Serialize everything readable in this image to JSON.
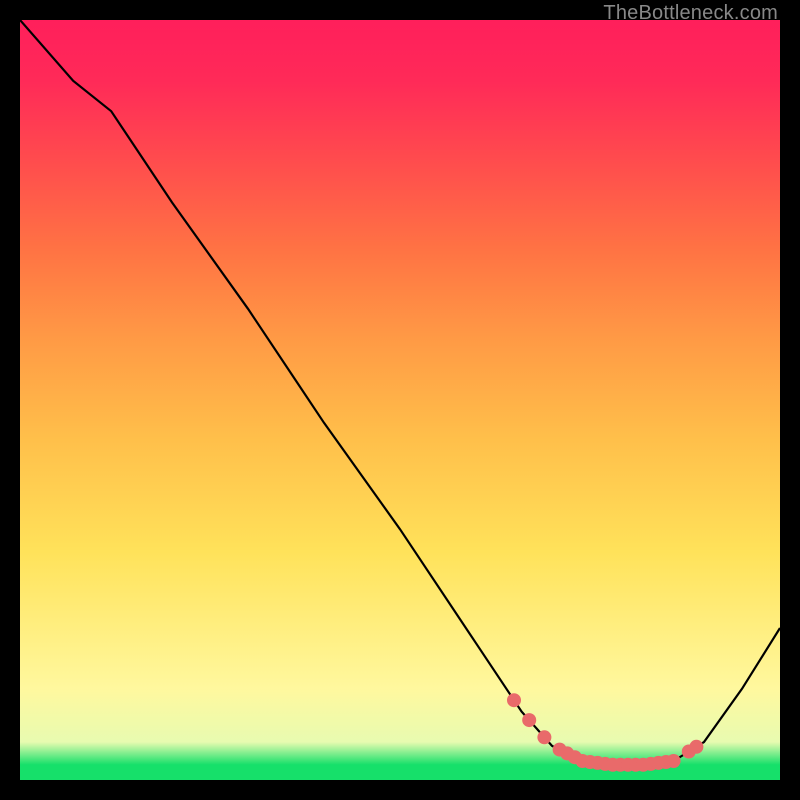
{
  "attribution": "TheBottleneck.com",
  "chart_data": {
    "type": "line",
    "title": "",
    "xlabel": "",
    "ylabel": "",
    "xlim": [
      0,
      100
    ],
    "ylim": [
      0,
      100
    ],
    "curve": {
      "name": "bottleneck-curve",
      "color": "#000000",
      "points": [
        {
          "x": 0,
          "y": 100.0
        },
        {
          "x": 7,
          "y": 92.0
        },
        {
          "x": 12,
          "y": 88.0
        },
        {
          "x": 20,
          "y": 76.0
        },
        {
          "x": 30,
          "y": 62.0
        },
        {
          "x": 40,
          "y": 47.0
        },
        {
          "x": 50,
          "y": 33.0
        },
        {
          "x": 60,
          "y": 18.0
        },
        {
          "x": 66,
          "y": 9.0
        },
        {
          "x": 70,
          "y": 4.5
        },
        {
          "x": 74,
          "y": 2.5
        },
        {
          "x": 78,
          "y": 2.0
        },
        {
          "x": 82,
          "y": 2.0
        },
        {
          "x": 86,
          "y": 2.5
        },
        {
          "x": 90,
          "y": 5.0
        },
        {
          "x": 95,
          "y": 12.0
        },
        {
          "x": 100,
          "y": 20.0
        }
      ]
    },
    "marker_xs": [
      65,
      67,
      69,
      71,
      72,
      73,
      74,
      75,
      76,
      77,
      78,
      79,
      80,
      81,
      82,
      83,
      84,
      85,
      86,
      88,
      89
    ],
    "marker_color": "#e96a6a",
    "marker_radius": 7
  }
}
